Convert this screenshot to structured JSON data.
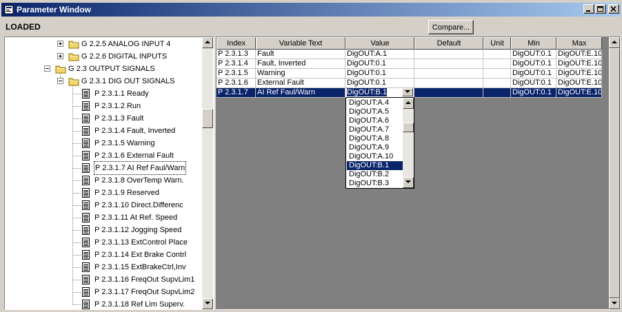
{
  "window": {
    "title": "Parameter Window"
  },
  "status": {
    "label": "LOADED"
  },
  "toolbar": {
    "compare_label": "Compare..."
  },
  "tree": {
    "items": [
      {
        "label": "G 2.2.5 ANALOG INPUT 4",
        "type": "group",
        "state": "collapsed"
      },
      {
        "label": "G 2.2.6 DIGITAL INPUTS",
        "type": "group",
        "state": "collapsed"
      },
      {
        "label": "G 2.3 OUTPUT SIGNALS",
        "type": "group",
        "state": "expanded"
      },
      {
        "label": "G 2.3.1 DIG OUT SIGNALS",
        "type": "group",
        "state": "expanded"
      },
      {
        "label": "P 2.3.1.1 Ready",
        "type": "param"
      },
      {
        "label": "P 2.3.1.2 Run",
        "type": "param"
      },
      {
        "label": "P 2.3.1.3 Fault",
        "type": "param"
      },
      {
        "label": "P 2.3.1.4 Fault, Inverted",
        "type": "param"
      },
      {
        "label": "P 2.3.1.5 Warning",
        "type": "param"
      },
      {
        "label": "P 2.3.1.6 External Fault",
        "type": "param"
      },
      {
        "label": "P 2.3.1.7 AI Ref Faul/Warn",
        "type": "param",
        "selected": true
      },
      {
        "label": "P 2.3.1.8 OverTemp Warn.",
        "type": "param"
      },
      {
        "label": "P 2.3.1.9 Reserved",
        "type": "param"
      },
      {
        "label": "P 2.3.1.10 Direct.Differenc",
        "type": "param"
      },
      {
        "label": "P 2.3.1.11 At Ref. Speed",
        "type": "param"
      },
      {
        "label": "P 2.3.1.12 Jogging Speed",
        "type": "param"
      },
      {
        "label": "P 2.3.1.13 ExtControl Place",
        "type": "param"
      },
      {
        "label": "P 2.3.1.14 Ext Brake Contrl",
        "type": "param"
      },
      {
        "label": "P 2.3.1.15 ExtBrakeCtrl,Inv",
        "type": "param"
      },
      {
        "label": "P 2.3.1.16 FreqOut SupvLim1",
        "type": "param"
      },
      {
        "label": "P 2.3.1.17 FreqOut SupvLim2",
        "type": "param"
      },
      {
        "label": "P 2.3.1.18 Ref Lim Superv.",
        "type": "param"
      }
    ]
  },
  "grid": {
    "columns": [
      "Index",
      "Variable Text",
      "Value",
      "Default",
      "Unit",
      "Min",
      "Max"
    ],
    "rows": [
      {
        "index": "P 2.3.1.3",
        "text": "Fault",
        "value": "DigOUT:A.1",
        "default": "",
        "unit": "",
        "min": "DigOUT:0.1",
        "max": "DigOUT:E.10"
      },
      {
        "index": "P 2.3.1.4",
        "text": "Fault, Inverted",
        "value": "DigOUT:0.1",
        "default": "",
        "unit": "",
        "min": "DigOUT:0.1",
        "max": "DigOUT:E.10"
      },
      {
        "index": "P 2.3.1.5",
        "text": "Warning",
        "value": "DigOUT:0.1",
        "default": "",
        "unit": "",
        "min": "DigOUT:0.1",
        "max": "DigOUT:E.10"
      },
      {
        "index": "P 2.3.1.6",
        "text": "External Fault",
        "value": "DigOUT:0.1",
        "default": "",
        "unit": "",
        "min": "DigOUT:0.1",
        "max": "DigOUT:E.10"
      },
      {
        "index": "P 2.3.1.7",
        "text": "AI Ref Faul/Warn",
        "value": "DigOUT:B.1",
        "default": "",
        "unit": "",
        "min": "DigOUT:0.1",
        "max": "DigOUT:E.10",
        "selected": true
      }
    ]
  },
  "dropdown": {
    "options": [
      "DigOUT:A.4",
      "DigOUT:A.5",
      "DigOUT:A.6",
      "DigOUT:A.7",
      "DigOUT:A.8",
      "DigOUT:A.9",
      "DigOUT:A.10",
      "DigOUT:B.1",
      "DigOUT:B.2",
      "DigOUT:B.3"
    ],
    "selected": "DigOUT:B.1"
  },
  "colors": {
    "selection": "#0a246a",
    "titlebar_start": "#0a246a",
    "titlebar_end": "#a6caf0",
    "face": "#d4d0c8",
    "folder": "#f2d567"
  },
  "icons": {
    "app": "parameter-app-icon",
    "group": "folder-icon",
    "param": "document-icon",
    "minimize": "minimize-icon",
    "maximize": "maximize-icon",
    "close": "close-icon"
  }
}
